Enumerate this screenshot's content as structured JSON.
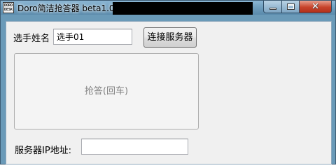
{
  "window": {
    "title": "Doro简洁抢答器 beta1.0",
    "icon_text": "DORO\nDESK",
    "controls": {
      "minimize": "minimize-icon",
      "maximize": "maximize-icon",
      "close": "close-icon",
      "close_glyph": "✕"
    }
  },
  "form": {
    "name_label": "选手姓名",
    "name_value": "选手01",
    "connect_button": "连接服务器",
    "answer_button": "抢答(回车)",
    "ip_label": "服务器IP地址:",
    "ip_value": ""
  },
  "colors": {
    "title_bar": "#6e9dbd",
    "client_bg": "#f0f0f0",
    "close_button": "#c7432a"
  }
}
